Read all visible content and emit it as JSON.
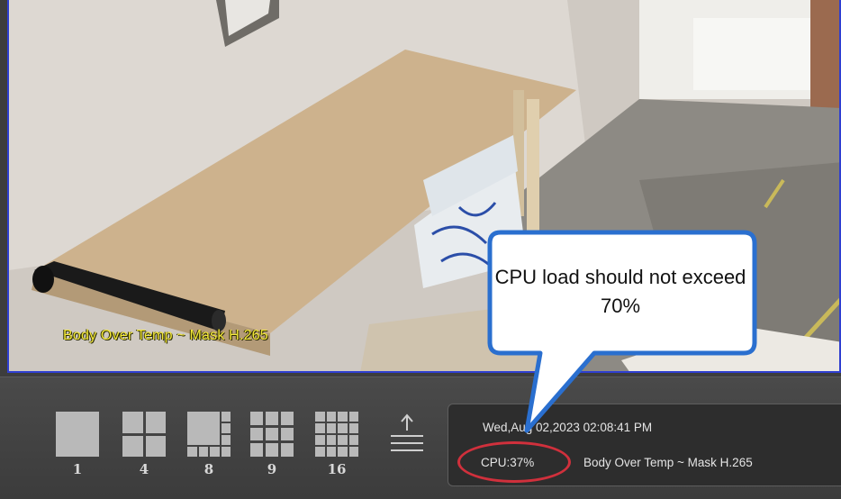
{
  "camera": {
    "osd_label": "Body Over Temp ~ Mask H.265"
  },
  "layouts": [
    {
      "label": "1"
    },
    {
      "label": "4"
    },
    {
      "label": "8"
    },
    {
      "label": "9"
    },
    {
      "label": "16"
    }
  ],
  "status": {
    "datetime": "Wed,Aug 02,2023  02:08:41 PM",
    "cpu": "CPU:37%",
    "mode": "Body Over Temp ~ Mask H.265"
  },
  "annotation": {
    "callout_text": "CPU load should not exceed 70%",
    "callout_color": "#2a6fcf",
    "ellipse_color": "#d0303c"
  },
  "icons": {
    "upload": "upload-arrow-icon"
  }
}
